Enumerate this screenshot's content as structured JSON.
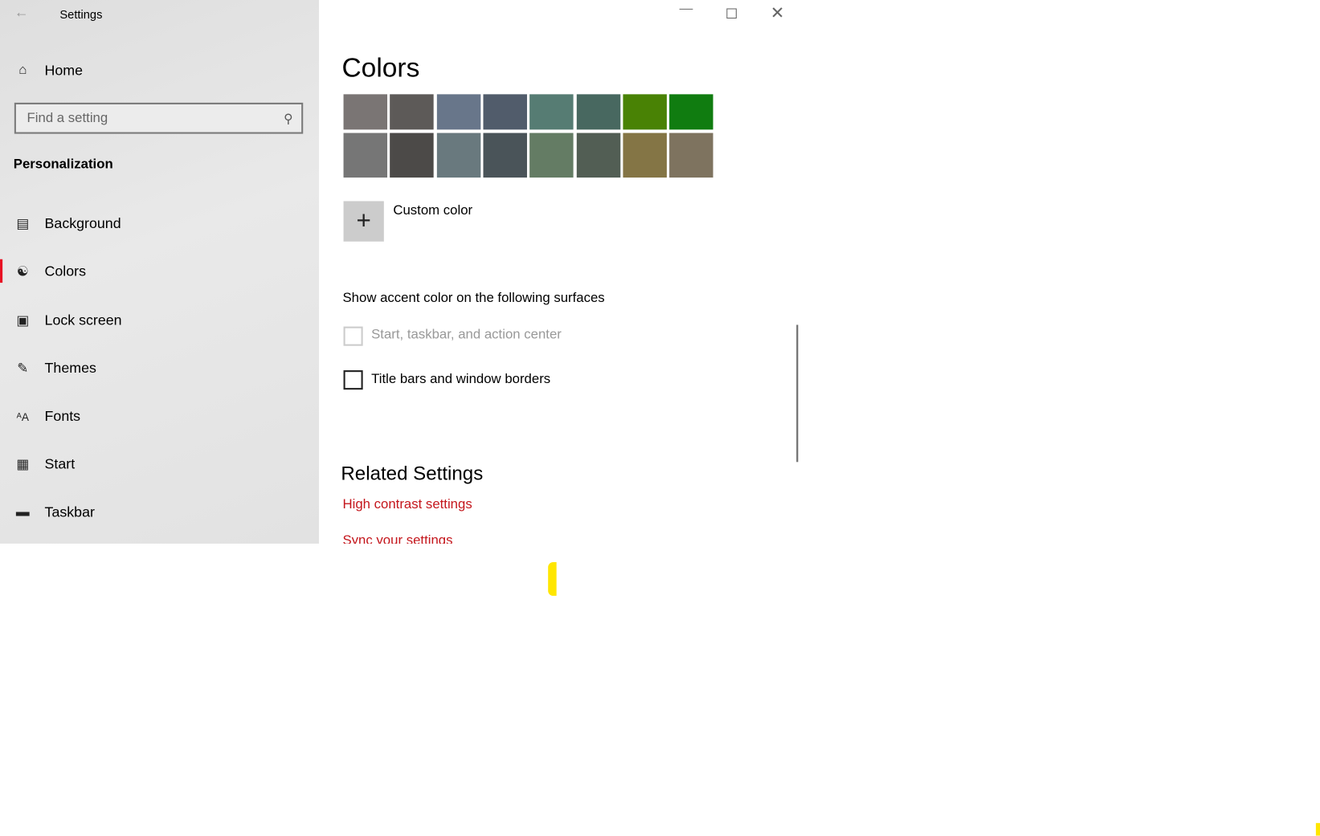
{
  "window": {
    "title": "Settings"
  },
  "sidebar": {
    "home": "Home",
    "search_placeholder": "Find a setting",
    "section": "Personalization",
    "items": [
      {
        "label": "Background",
        "icon": "image-icon"
      },
      {
        "label": "Colors",
        "icon": "palette-icon",
        "selected": true
      },
      {
        "label": "Lock screen",
        "icon": "lock-screen-icon"
      },
      {
        "label": "Themes",
        "icon": "themes-icon"
      },
      {
        "label": "Fonts",
        "icon": "fonts-icon"
      },
      {
        "label": "Start",
        "icon": "start-icon"
      },
      {
        "label": "Taskbar",
        "icon": "taskbar-icon"
      }
    ]
  },
  "main": {
    "title": "Colors",
    "swatches": [
      [
        "#7a7574",
        "#5d5a58",
        "#68768a",
        "#515c6b",
        "#567c73",
        "#486860",
        "#498205",
        "#107c10"
      ],
      [
        "#767676",
        "#4c4a48",
        "#69797e",
        "#4a5459",
        "#647c64",
        "#525e54",
        "#847545",
        "#7e735f"
      ]
    ],
    "custom_color": "Custom color",
    "surfaces_heading": "Show accent color on the following surfaces",
    "checkbox_start": "Start, taskbar, and action center",
    "checkbox_titlebars": "Title bars and window borders",
    "related_heading": "Related Settings",
    "link_high_contrast": "High contrast settings",
    "link_sync": "Sync your settings"
  },
  "colors": {
    "accent_link": "#c4161c",
    "selection": "#e81123"
  }
}
